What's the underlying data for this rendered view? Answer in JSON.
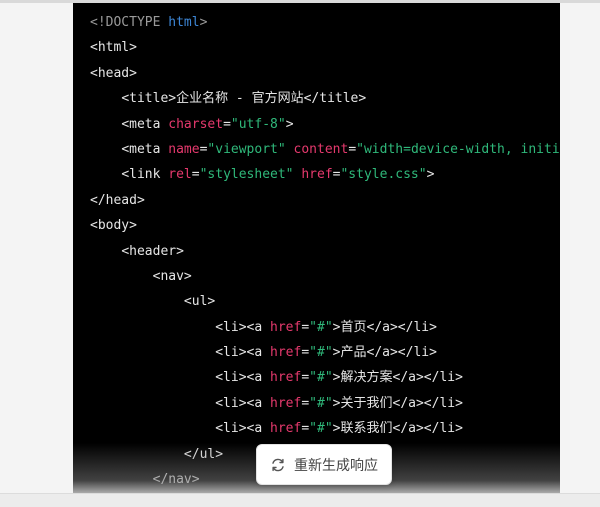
{
  "code_lines": [
    [
      {
        "t": "doctype",
        "v": "<!DOCTYPE "
      },
      {
        "t": "kw",
        "v": "html"
      },
      {
        "t": "doctype",
        "v": ">"
      }
    ],
    [
      {
        "t": "tag",
        "v": "<html>"
      }
    ],
    [
      {
        "t": "tag",
        "v": "<head>"
      }
    ],
    [
      {
        "t": "text",
        "v": "    "
      },
      {
        "t": "tag",
        "v": "<title>"
      },
      {
        "t": "text",
        "v": "企业名称 - 官方网站"
      },
      {
        "t": "tag",
        "v": "</title>"
      }
    ],
    [
      {
        "t": "text",
        "v": "    "
      },
      {
        "t": "tag",
        "v": "<meta "
      },
      {
        "t": "attr",
        "v": "charset"
      },
      {
        "t": "tag",
        "v": "="
      },
      {
        "t": "str",
        "v": "\"utf-8\""
      },
      {
        "t": "tag",
        "v": ">"
      }
    ],
    [
      {
        "t": "text",
        "v": "    "
      },
      {
        "t": "tag",
        "v": "<meta "
      },
      {
        "t": "attr",
        "v": "name"
      },
      {
        "t": "tag",
        "v": "="
      },
      {
        "t": "str",
        "v": "\"viewport\""
      },
      {
        "t": "tag",
        "v": " "
      },
      {
        "t": "attr",
        "v": "content"
      },
      {
        "t": "tag",
        "v": "="
      },
      {
        "t": "str",
        "v": "\"width=device-width, initial-s"
      }
    ],
    [
      {
        "t": "text",
        "v": "    "
      },
      {
        "t": "tag",
        "v": "<link "
      },
      {
        "t": "attr",
        "v": "rel"
      },
      {
        "t": "tag",
        "v": "="
      },
      {
        "t": "str",
        "v": "\"stylesheet\""
      },
      {
        "t": "tag",
        "v": " "
      },
      {
        "t": "attr",
        "v": "href"
      },
      {
        "t": "tag",
        "v": "="
      },
      {
        "t": "str",
        "v": "\"style.css\""
      },
      {
        "t": "tag",
        "v": ">"
      }
    ],
    [
      {
        "t": "tag",
        "v": "</head>"
      }
    ],
    [
      {
        "t": "tag",
        "v": "<body>"
      }
    ],
    [
      {
        "t": "text",
        "v": "    "
      },
      {
        "t": "tag",
        "v": "<header>"
      }
    ],
    [
      {
        "t": "text",
        "v": "        "
      },
      {
        "t": "tag",
        "v": "<nav>"
      }
    ],
    [
      {
        "t": "text",
        "v": "            "
      },
      {
        "t": "tag",
        "v": "<ul>"
      }
    ],
    [
      {
        "t": "text",
        "v": "                "
      },
      {
        "t": "tag",
        "v": "<li><a "
      },
      {
        "t": "attr",
        "v": "href"
      },
      {
        "t": "tag",
        "v": "="
      },
      {
        "t": "str",
        "v": "\"#\""
      },
      {
        "t": "tag",
        "v": ">"
      },
      {
        "t": "text",
        "v": "首页"
      },
      {
        "t": "tag",
        "v": "</a></li>"
      }
    ],
    [
      {
        "t": "text",
        "v": "                "
      },
      {
        "t": "tag",
        "v": "<li><a "
      },
      {
        "t": "attr",
        "v": "href"
      },
      {
        "t": "tag",
        "v": "="
      },
      {
        "t": "str",
        "v": "\"#\""
      },
      {
        "t": "tag",
        "v": ">"
      },
      {
        "t": "text",
        "v": "产品"
      },
      {
        "t": "tag",
        "v": "</a></li>"
      }
    ],
    [
      {
        "t": "text",
        "v": "                "
      },
      {
        "t": "tag",
        "v": "<li><a "
      },
      {
        "t": "attr",
        "v": "href"
      },
      {
        "t": "tag",
        "v": "="
      },
      {
        "t": "str",
        "v": "\"#\""
      },
      {
        "t": "tag",
        "v": ">"
      },
      {
        "t": "text",
        "v": "解决方案"
      },
      {
        "t": "tag",
        "v": "</a></li>"
      }
    ],
    [
      {
        "t": "text",
        "v": "                "
      },
      {
        "t": "tag",
        "v": "<li><a "
      },
      {
        "t": "attr",
        "v": "href"
      },
      {
        "t": "tag",
        "v": "="
      },
      {
        "t": "str",
        "v": "\"#\""
      },
      {
        "t": "tag",
        "v": ">"
      },
      {
        "t": "text",
        "v": "关于我们"
      },
      {
        "t": "tag",
        "v": "</a></li>"
      }
    ],
    [
      {
        "t": "text",
        "v": "                "
      },
      {
        "t": "tag",
        "v": "<li><a "
      },
      {
        "t": "attr",
        "v": "href"
      },
      {
        "t": "tag",
        "v": "="
      },
      {
        "t": "str",
        "v": "\"#\""
      },
      {
        "t": "tag",
        "v": ">"
      },
      {
        "t": "text",
        "v": "联系我们"
      },
      {
        "t": "tag",
        "v": "</a></li>"
      }
    ],
    [
      {
        "t": "text",
        "v": "            "
      },
      {
        "t": "tag",
        "v": "</ul>"
      }
    ],
    [
      {
        "t": "text",
        "v": "        "
      },
      {
        "t": "tag",
        "v": "</nav>"
      }
    ]
  ],
  "colors": {
    "code_background": "#000000",
    "tag": "#e6e6e6",
    "keyword": "#3d86d6",
    "attribute": "#e5396d",
    "string": "#2fb87a"
  },
  "regenerate_button": {
    "label": "重新生成响应",
    "icon": "refresh-icon"
  }
}
